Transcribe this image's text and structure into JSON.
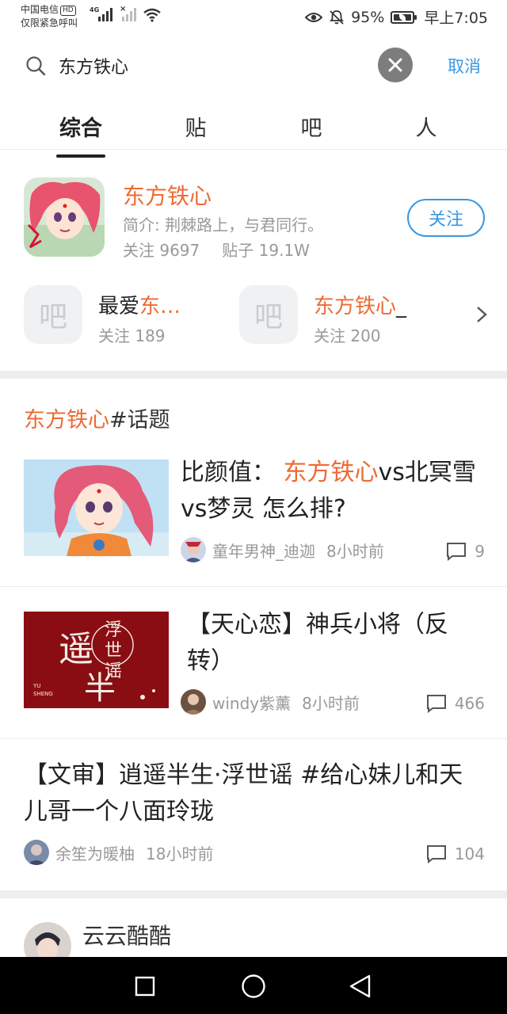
{
  "status_bar": {
    "carrier": "中国电信",
    "hd_badge": "HD",
    "emergency": "仅限紧急呼叫",
    "network": "4G",
    "battery": "95%",
    "time": "早上7:05"
  },
  "search": {
    "query": "东方铁心",
    "cancel_label": "取消"
  },
  "tabs": [
    {
      "label": "综合",
      "active": true
    },
    {
      "label": "贴",
      "active": false
    },
    {
      "label": "吧",
      "active": false
    },
    {
      "label": "人",
      "active": false
    }
  ],
  "forum": {
    "name": "东方铁心",
    "description": "简介: 荆棘路上，与君同行。",
    "followers": "关注 9697",
    "posts": "贴子 19.1W",
    "follow_label": "关注"
  },
  "related_forums": [
    {
      "icon_text": "吧",
      "name_prefix": "最爱",
      "name_highlight": "东…",
      "name_suffix": "",
      "count": "关注 189"
    },
    {
      "icon_text": "吧",
      "name_prefix": "",
      "name_highlight": "东方铁心",
      "name_suffix": "_",
      "count": "关注 200"
    }
  ],
  "topic": {
    "highlight": "东方铁心",
    "suffix": "#话题"
  },
  "posts": [
    {
      "title_prefix": "比颜值：",
      "title_highlight": "东方铁心",
      "title_suffix": "vs北冥雪vs梦灵 怎么排?",
      "author": "童年男神_迪迦",
      "time": "8小时前",
      "comments": "9"
    },
    {
      "title": "【天心恋】神兵小将（反转）",
      "author": "windy紫薰",
      "time": "8小时前",
      "comments": "466",
      "thumb_text": [
        "遥",
        "半",
        "浮",
        "世",
        "谣",
        "YU",
        "SHENG"
      ]
    },
    {
      "title": "【文审】逍遥半生·浮世谣 #给心妹儿和天儿哥一个八面玲珑",
      "author": "余笙为暖柚",
      "time": "18小时前",
      "comments": "104"
    }
  ],
  "user": {
    "name": "云云酷酷"
  },
  "colors": {
    "highlight": "#ed6a34",
    "accent": "#3a97e0",
    "muted": "#999999"
  }
}
